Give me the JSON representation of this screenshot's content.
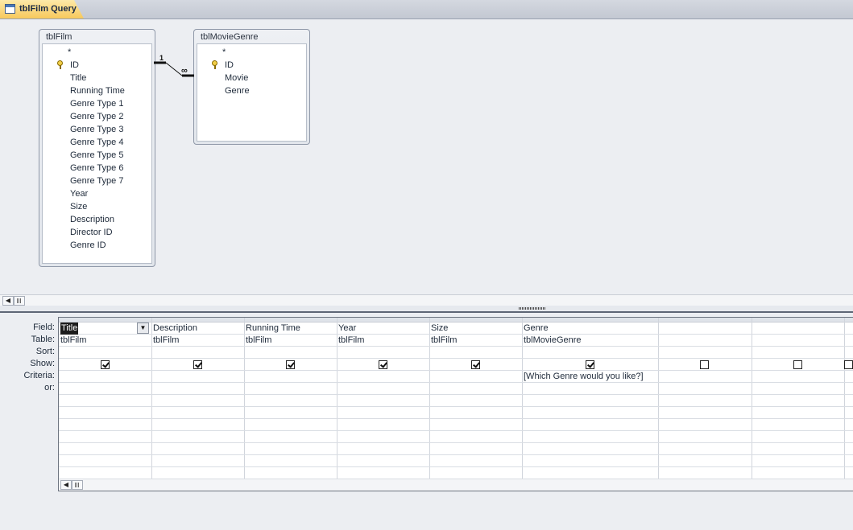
{
  "tab": {
    "label": "tblFilm Query",
    "icon": "query-icon"
  },
  "tables": [
    {
      "title": "tblFilm",
      "fields": [
        "*",
        "ID",
        "Title",
        "Running Time",
        "Genre Type 1",
        "Genre Type 2",
        "Genre Type 3",
        "Genre Type 4",
        "Genre Type 5",
        "Genre Type 6",
        "Genre Type 7",
        "Year",
        "Size",
        "Description",
        "Director ID",
        "Genre ID"
      ],
      "key_field": "ID"
    },
    {
      "title": "tblMovieGenre",
      "fields": [
        "*",
        "ID",
        "Movie",
        "Genre"
      ],
      "key_field": "ID"
    }
  ],
  "relationship": {
    "one": "1",
    "many": "∞"
  },
  "grid": {
    "row_labels": [
      "Field:",
      "Table:",
      "Sort:",
      "Show:",
      "Criteria:",
      "or:"
    ],
    "columns": [
      {
        "field": "Title",
        "table": "tblFilm",
        "sort": "",
        "show": true,
        "criteria": "",
        "or": ""
      },
      {
        "field": "Description",
        "table": "tblFilm",
        "sort": "",
        "show": true,
        "criteria": "",
        "or": ""
      },
      {
        "field": "Running Time",
        "table": "tblFilm",
        "sort": "",
        "show": true,
        "criteria": "",
        "or": ""
      },
      {
        "field": "Year",
        "table": "tblFilm",
        "sort": "",
        "show": true,
        "criteria": "",
        "or": ""
      },
      {
        "field": "Size",
        "table": "tblFilm",
        "sort": "",
        "show": true,
        "criteria": "",
        "or": ""
      },
      {
        "field": "Genre",
        "table": "tblMovieGenre",
        "sort": "",
        "show": true,
        "criteria": "[Which Genre would you like?]",
        "or": ""
      },
      {
        "field": "",
        "table": "",
        "sort": "",
        "show": false,
        "criteria": "",
        "or": ""
      },
      {
        "field": "",
        "table": "",
        "sort": "",
        "show": false,
        "criteria": "",
        "or": ""
      },
      {
        "field": "",
        "table": "",
        "sort": "",
        "show": false,
        "criteria": "",
        "or": ""
      }
    ]
  }
}
